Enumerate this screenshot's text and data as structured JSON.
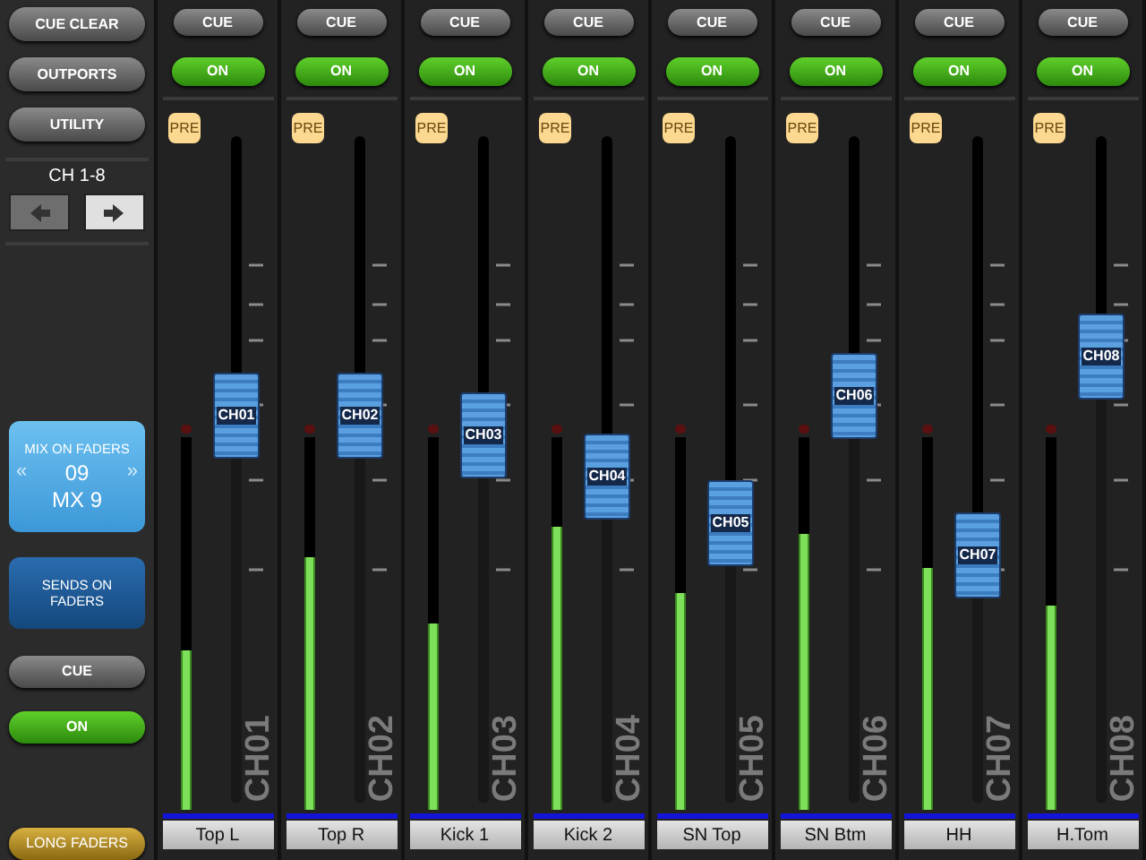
{
  "sidebar": {
    "buttons": [
      {
        "label": "CUE CLEAR"
      },
      {
        "label": "OUTPORTS"
      },
      {
        "label": "UTILITY"
      }
    ],
    "bank": {
      "label": "CH 1-8",
      "prev_enabled": false,
      "next_enabled": true
    },
    "mix_selector": {
      "title": "MIX ON FADERS",
      "prev": "«",
      "number": "09",
      "next": "»",
      "name": "MX 9",
      "selected": true
    },
    "sends_button": {
      "label": "SENDS ON FADERS",
      "selected": false
    },
    "cue": {
      "label": "CUE",
      "on": false
    },
    "on": {
      "label": "ON",
      "on": true
    },
    "long_faders": {
      "label": "LONG FADERS"
    }
  },
  "channels": [
    {
      "cue": {
        "label": "CUE",
        "on": false
      },
      "on": {
        "label": "ON",
        "on": true
      },
      "pre": "PRE",
      "fader": {
        "label": "CH01",
        "level": 0.58
      },
      "meter": {
        "level": 0.43
      },
      "strip_id": "CH01",
      "name": "Top L"
    },
    {
      "cue": {
        "label": "CUE",
        "on": false
      },
      "on": {
        "label": "ON",
        "on": true
      },
      "pre": "PRE",
      "fader": {
        "label": "CH02",
        "level": 0.58
      },
      "meter": {
        "level": 0.68
      },
      "strip_id": "CH02",
      "name": "Top R"
    },
    {
      "cue": {
        "label": "CUE",
        "on": false
      },
      "on": {
        "label": "ON",
        "on": true
      },
      "pre": "PRE",
      "fader": {
        "label": "CH03",
        "level": 0.55
      },
      "meter": {
        "level": 0.5
      },
      "strip_id": "CH03",
      "name": "Kick 1"
    },
    {
      "cue": {
        "label": "CUE",
        "on": false
      },
      "on": {
        "label": "ON",
        "on": true
      },
      "pre": "PRE",
      "fader": {
        "label": "CH04",
        "level": 0.49
      },
      "meter": {
        "level": 0.76
      },
      "strip_id": "CH04",
      "name": "Kick 2"
    },
    {
      "cue": {
        "label": "CUE",
        "on": false
      },
      "on": {
        "label": "ON",
        "on": true
      },
      "pre": "PRE",
      "fader": {
        "label": "CH05",
        "level": 0.42
      },
      "meter": {
        "level": 0.58
      },
      "strip_id": "CH05",
      "name": "SN Top"
    },
    {
      "cue": {
        "label": "CUE",
        "on": false
      },
      "on": {
        "label": "ON",
        "on": true
      },
      "pre": "PRE",
      "fader": {
        "label": "CH06",
        "level": 0.61
      },
      "meter": {
        "level": 0.74
      },
      "strip_id": "CH06",
      "name": "SN Btm"
    },
    {
      "cue": {
        "label": "CUE",
        "on": false
      },
      "on": {
        "label": "ON",
        "on": true
      },
      "pre": "PRE",
      "fader": {
        "label": "CH07",
        "level": 0.37
      },
      "meter": {
        "level": 0.65
      },
      "strip_id": "CH07",
      "name": "HH"
    },
    {
      "cue": {
        "label": "CUE",
        "on": false
      },
      "on": {
        "label": "ON",
        "on": true
      },
      "pre": "PRE",
      "fader": {
        "label": "CH08",
        "level": 0.67
      },
      "meter": {
        "level": 0.55
      },
      "strip_id": "CH08",
      "name": "H.Tom"
    }
  ]
}
